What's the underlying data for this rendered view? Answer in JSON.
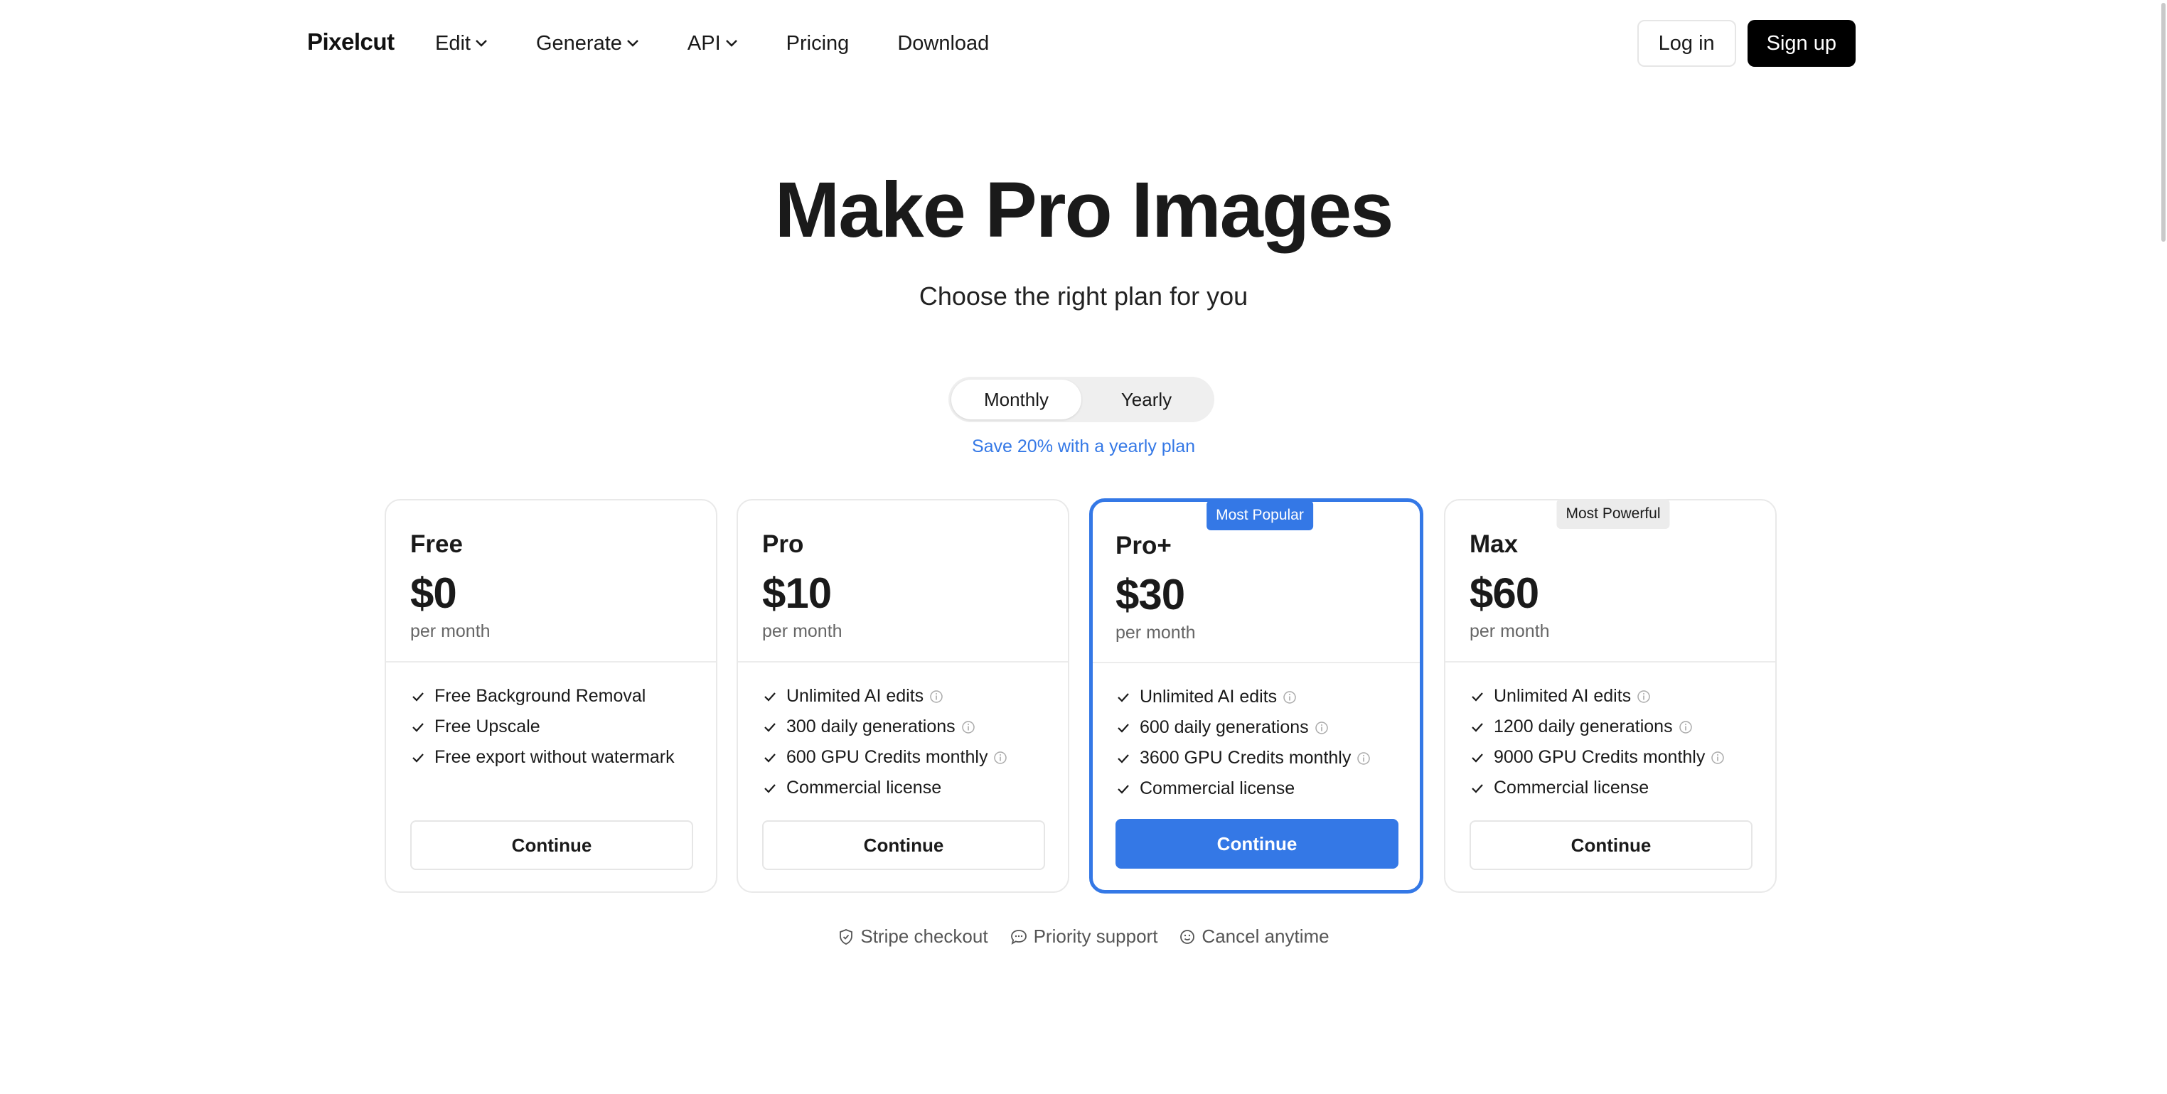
{
  "nav": {
    "logo": "Pixelcut",
    "links": [
      {
        "label": "Edit",
        "dropdown": true
      },
      {
        "label": "Generate",
        "dropdown": true
      },
      {
        "label": "API",
        "dropdown": true
      },
      {
        "label": "Pricing",
        "dropdown": false
      },
      {
        "label": "Download",
        "dropdown": false
      }
    ],
    "login_label": "Log in",
    "signup_label": "Sign up"
  },
  "hero": {
    "title": "Make Pro Images",
    "subtitle": "Choose the right plan for you"
  },
  "billing": {
    "options": [
      "Monthly",
      "Yearly"
    ],
    "selected": "Monthly",
    "save_note": "Save 20% with a yearly plan"
  },
  "plans": [
    {
      "name": "Free",
      "price": "$0",
      "period": "per month",
      "badge": "",
      "features": [
        {
          "text": "Free Background Removal",
          "info": false
        },
        {
          "text": "Free Upscale",
          "info": false
        },
        {
          "text": "Free export without watermark",
          "info": false
        }
      ],
      "cta": "Continue"
    },
    {
      "name": "Pro",
      "price": "$10",
      "period": "per month",
      "badge": "",
      "features": [
        {
          "text": "Unlimited AI edits",
          "info": true
        },
        {
          "text": "300 daily generations",
          "info": true
        },
        {
          "text": "600 GPU Credits monthly",
          "info": true
        },
        {
          "text": "Commercial license",
          "info": false
        }
      ],
      "cta": "Continue"
    },
    {
      "name": "Pro+",
      "price": "$30",
      "period": "per month",
      "badge": "Most Popular",
      "features": [
        {
          "text": "Unlimited AI edits",
          "info": true
        },
        {
          "text": "600 daily generations",
          "info": true
        },
        {
          "text": "3600 GPU Credits monthly",
          "info": true
        },
        {
          "text": "Commercial license",
          "info": false
        }
      ],
      "cta": "Continue"
    },
    {
      "name": "Max",
      "price": "$60",
      "period": "per month",
      "badge": "Most Powerful",
      "features": [
        {
          "text": "Unlimited AI edits",
          "info": true
        },
        {
          "text": "1200 daily generations",
          "info": true
        },
        {
          "text": "9000 GPU Credits monthly",
          "info": true
        },
        {
          "text": "Commercial license",
          "info": false
        }
      ],
      "cta": "Continue"
    }
  ],
  "trust": [
    {
      "icon": "shield-check-icon",
      "label": "Stripe checkout"
    },
    {
      "icon": "chat-bubble-icon",
      "label": "Priority support"
    },
    {
      "icon": "smiley-icon",
      "label": "Cancel anytime"
    }
  ],
  "colors": {
    "accent": "#3478e6",
    "text": "#1a1a1a",
    "muted": "#666666",
    "border": "#e9e9e9"
  }
}
